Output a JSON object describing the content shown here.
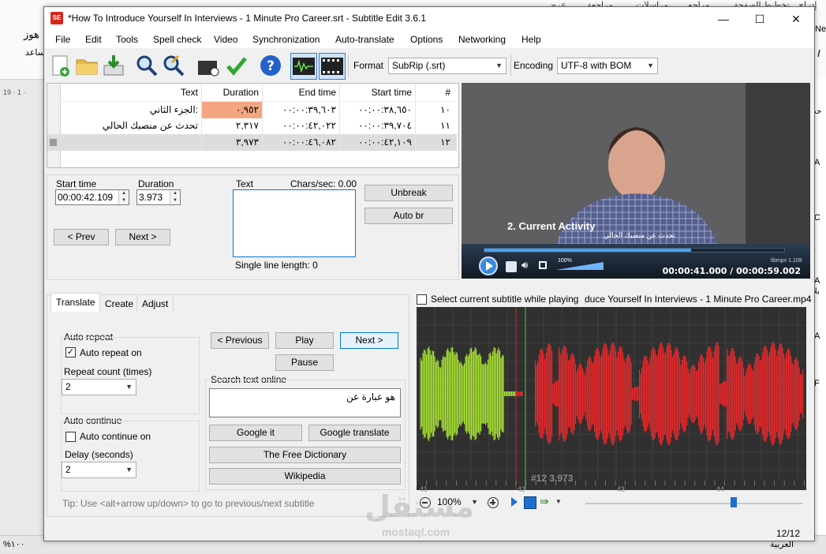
{
  "background": {
    "ribbon_tabs": [
      "إدراج",
      "تخطيط الصفحة",
      "مراجع",
      "مراسلات",
      "مراجعة",
      "عرض"
    ],
    "left_snippets": [
      "هوز",
      "ساعد"
    ],
    "ruler_numbers": "19 · 1 ·",
    "right_letters": [
      "Ne",
      "I",
      "A",
      "C",
      "A",
      "A",
      "F"
    ],
    "right_arabic": [
      "حد",
      "بلا"
    ],
    "status_left": "%١٠٠",
    "status_right": "العربية"
  },
  "window": {
    "title": "*How To Introduce Yourself In Interviews - 1 Minute Pro Career.srt - Subtitle Edit 3.6.1",
    "icon_text": "SE",
    "minimize": "—",
    "maximize": "☐",
    "close": "✕"
  },
  "menu": [
    "File",
    "Edit",
    "Tools",
    "Spell check",
    "Video",
    "Synchronization",
    "Auto-translate",
    "Options",
    "Networking",
    "Help"
  ],
  "toolbar": {
    "icons": [
      "new-file-icon",
      "open-folder-icon",
      "save-icon",
      "find-icon",
      "replace-icon",
      "visual-sync-icon",
      "spell-check-icon",
      "help-icon",
      "waveform-toggle-icon",
      "video-toggle-icon"
    ],
    "format_label": "Format",
    "format_value": "SubRip (.srt)",
    "encoding_label": "Encoding",
    "encoding_value": "UTF-8 with BOM"
  },
  "grid": {
    "headers": {
      "text": "Text",
      "duration": "Duration",
      "end": "End time",
      "start": "Start time",
      "number": "#"
    },
    "rows": [
      {
        "number": "١٠",
        "start": "٠٠:٠٠:٣٨,٦٥٠",
        "end": "٠٠:٠٠:٣٩,٦٠٣",
        "duration": "٠,٩٥٢",
        "text": "الجزء الثاني:",
        "selected": false,
        "duration_warn": true
      },
      {
        "number": "١١",
        "start": "٠٠:٠٠:٣٩,٧٠٤",
        "end": "٠٠:٠٠:٤٢,٠٢٢",
        "duration": "٢,٣١٧",
        "text": "تحدث عن منصبك الحالي",
        "selected": false,
        "duration_warn": false
      },
      {
        "number": "١٢",
        "start": "٠٠:٠٠:٤٢,١٠٩",
        "end": "٠٠:٠٠:٤٦,٠٨٢",
        "duration": "٣,٩٧٣",
        "text": "",
        "selected": true,
        "duration_warn": false
      }
    ],
    "warn_color": "#f4a582"
  },
  "editor": {
    "start_time_label": "Start time",
    "start_time_value": "00:00:42.109",
    "duration_label": "Duration",
    "duration_value": "3.973",
    "text_label": "Text",
    "chars_per_sec": "Chars/sec: 0.00",
    "single_line_length": "Single line length: 0",
    "prev_button": "< Prev",
    "next_button": "Next >",
    "unbreak_button": "Unbreak",
    "auto_br_button": "Auto br"
  },
  "video": {
    "overlay_title": "2. Current Activity",
    "overlay_subtitle": "تحدث عن منصبك الحالي",
    "volume": "100%",
    "player_name": "libmpv 1.109",
    "timecode": "00:00:41.000 / 00:00:59.002",
    "progress_fraction": 0.69,
    "volume_fraction": 1.0
  },
  "tabs": {
    "items": [
      "Translate",
      "Create",
      "Adjust"
    ],
    "active": "Translate"
  },
  "translate": {
    "auto_repeat_group": "Auto repeat",
    "auto_repeat_on": "Auto repeat on",
    "auto_repeat_checked": true,
    "repeat_count_label": "Repeat count (times)",
    "repeat_count_value": "2",
    "auto_continue_group": "Auto continue",
    "auto_continue_on": "Auto continue on",
    "auto_continue_checked": false,
    "delay_label": "Delay (seconds)",
    "delay_value": "2",
    "previous_button": "< Previous",
    "play_button": "Play",
    "next_button": "Next >",
    "pause_button": "Pause",
    "search_group": "Search text online",
    "search_text": "هو عبارة عن",
    "google_it": "Google it",
    "google_translate": "Google translate",
    "free_dictionary": "The Free Dictionary",
    "wikipedia": "Wikipedia",
    "tip": "Tip: Use <alt+arrow up/down> to go to previous/next subtitle"
  },
  "waveform": {
    "select_checkbox": "Select current subtitle while playing",
    "media_file": "duce Yourself In Interviews - 1 Minute Pro Career.mp4",
    "select_checked": false,
    "current_label": "#12  3.973",
    "tick_labels": [
      "41",
      "42",
      "43",
      "44"
    ],
    "zoom": "100%",
    "colors": {
      "background": "#303030",
      "past": "#a8e234",
      "selected": "#e8282b",
      "grid": "#4a4a4a"
    }
  },
  "status": {
    "line_count": "12/12"
  },
  "watermark": {
    "arabic": "مستقل",
    "latin": "mostaql.com"
  }
}
